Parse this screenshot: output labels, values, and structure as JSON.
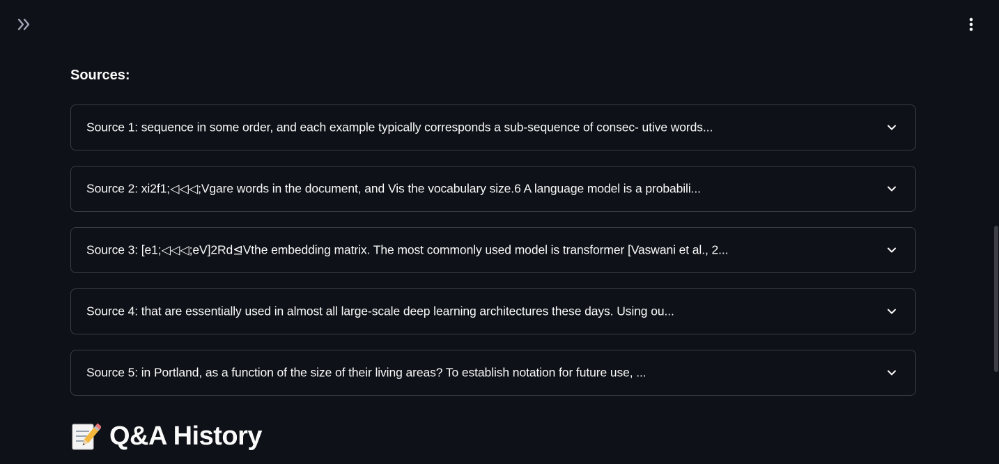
{
  "header": {
    "sidebar_toggle_icon": "double-chevron-right-icon",
    "menu_icon": "vertical-ellipsis-icon"
  },
  "sources": {
    "heading": "Sources:",
    "items": [
      {
        "label": "Source 1: sequence in some order, and each example typically corresponds a sub-sequence of consec- utive words..."
      },
      {
        "label": "Source 2: xi2f1;◁◁◁;Vgare words in the document, and Vis the vocabulary size.6 A language model is a probabili..."
      },
      {
        "label": "Source 3: [e1;◁◁◁;eV]2Rd⊴Vthe embedding matrix. The most commonly used model is transformer [Vaswani et al., 2..."
      },
      {
        "label": "Source 4: that are essentially used in almost all large-scale deep learning architectures these days. Using ou..."
      },
      {
        "label": "Source 5: in Portland, as a function of the size of their living areas? To establish notation for future use, ..."
      }
    ],
    "expand_icon": "chevron-down-icon"
  },
  "qa_history": {
    "icon": "memo-pencil-icon",
    "title": "Q&A History"
  },
  "colors": {
    "background": "#0e1117",
    "text": "#fafafa",
    "border": "#3b3d45"
  }
}
